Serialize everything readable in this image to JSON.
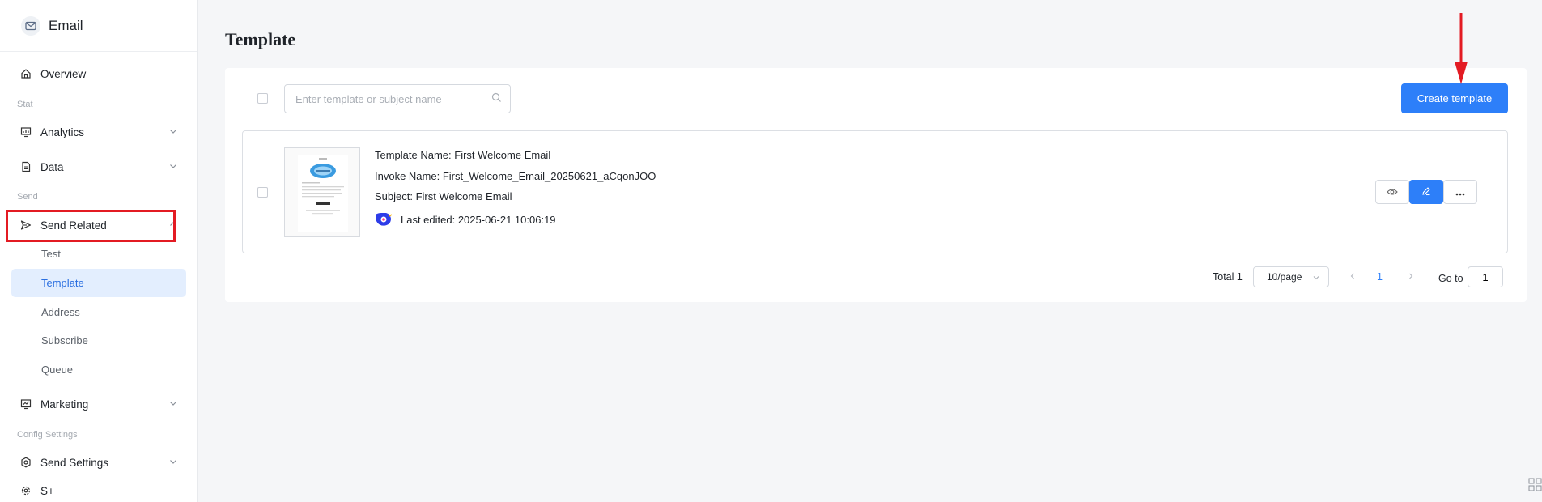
{
  "app": {
    "title": "Email",
    "icon": "mail-icon"
  },
  "sidebar": {
    "overview": {
      "label": "Overview",
      "icon": "home-icon"
    },
    "groups": {
      "stat": "Stat",
      "send": "Send",
      "config": "Config Settings"
    },
    "analytics": {
      "label": "Analytics",
      "icon": "analytics-icon"
    },
    "data": {
      "label": "Data",
      "icon": "document-icon"
    },
    "send_related": {
      "label": "Send Related",
      "icon": "send-icon",
      "expanded": true,
      "children": [
        {
          "label": "Test",
          "active": false
        },
        {
          "label": "Template",
          "active": true
        },
        {
          "label": "Address",
          "active": false
        },
        {
          "label": "Subscribe",
          "active": false
        },
        {
          "label": "Queue",
          "active": false
        }
      ]
    },
    "marketing": {
      "label": "Marketing",
      "icon": "marketing-icon"
    },
    "send_settings": {
      "label": "Send Settings",
      "icon": "gear-icon"
    },
    "splus": {
      "label": "S+",
      "icon": "gear-icon"
    }
  },
  "main": {
    "page_title": "Template",
    "search": {
      "placeholder": "Enter template or subject name",
      "value": ""
    },
    "create_button": "Create template",
    "templates": [
      {
        "name_label": "Template Name: First Welcome Email",
        "invoke_label": "Invoke Name: First_Welcome_Email_20250621_aCqonJOO",
        "subject_label": "Subject: First Welcome Email",
        "edited_label": "Last edited: 2025-06-21 10:06:19"
      }
    ],
    "pagination": {
      "total": "Total 1",
      "page_size": "10/page",
      "current_page": "1",
      "goto_label": "Go to",
      "goto_value": "1"
    }
  },
  "colors": {
    "accent": "#2d7ff9",
    "highlight": "#e31b23",
    "active_bg": "#e3eefe"
  }
}
